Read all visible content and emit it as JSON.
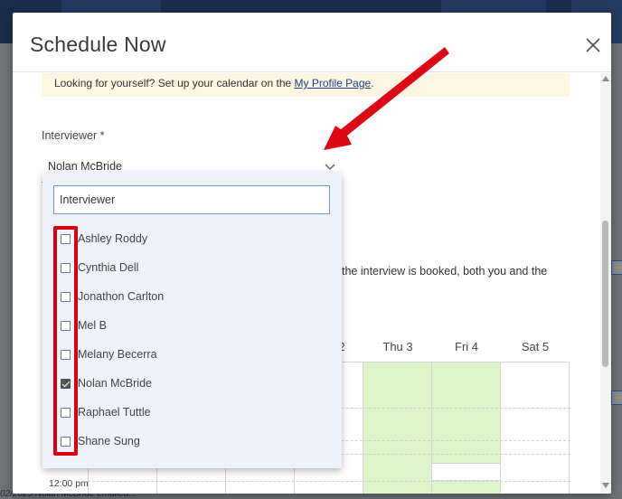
{
  "background": {
    "footer_text": "02/2025 Nolan McBride emailed..."
  },
  "modal": {
    "title": "Schedule Now",
    "notice": {
      "text": "Looking for yourself? Set up your calendar on the ",
      "link": "My Profile Page",
      "suffix": "."
    },
    "interviewer_label": "Interviewer *",
    "interviewer_value": "Nolan McBride",
    "partial_text": "the interview is booked, both you and the",
    "calendar": {
      "days": [
        "2",
        "Thu 3",
        "Fri 4",
        "Sat 5"
      ],
      "time_label": "12:00 pm"
    }
  },
  "dropdown": {
    "search_placeholder": "Interviewer",
    "options": [
      {
        "label": "Ashley Roddy",
        "checked": false
      },
      {
        "label": "Cynthia Dell",
        "checked": false
      },
      {
        "label": "Jonathon Carlton",
        "checked": false
      },
      {
        "label": "Mel B",
        "checked": false
      },
      {
        "label": "Melany Becerra",
        "checked": false
      },
      {
        "label": "Nolan McBride",
        "checked": true
      },
      {
        "label": "Raphael Tuttle",
        "checked": false
      },
      {
        "label": "Shane Sung",
        "checked": false
      }
    ]
  },
  "colors": {
    "annotation": "#d9000d",
    "available_slot": "#ddf5c8",
    "notice_bg": "#fdf6e3"
  }
}
